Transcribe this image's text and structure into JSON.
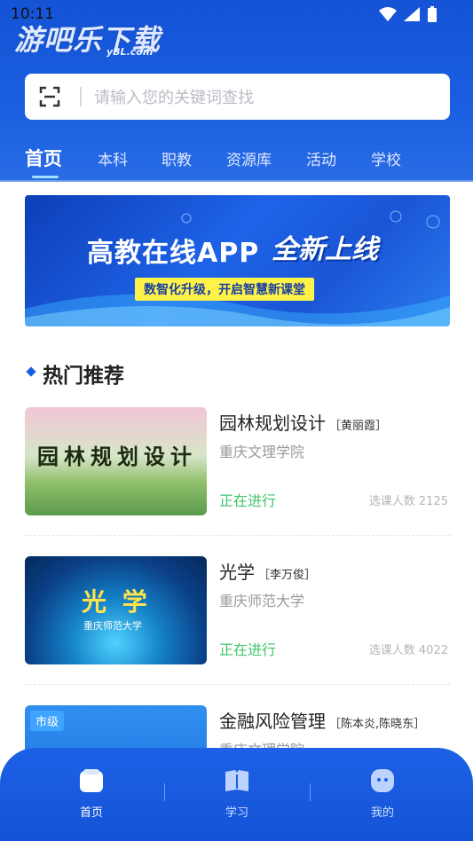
{
  "status_bar": {
    "time": "10:11"
  },
  "watermark": {
    "title": "游吧乐下载",
    "domain": "yBL.com"
  },
  "search": {
    "placeholder": "请输入您的关键词查找"
  },
  "tabs": [
    {
      "label": "首页"
    },
    {
      "label": "本科"
    },
    {
      "label": "职教"
    },
    {
      "label": "资源库"
    },
    {
      "label": "活动"
    },
    {
      "label": "学校"
    }
  ],
  "banner": {
    "title": "高教在线APP",
    "title_highlight": "全新上线",
    "subtitle": "数智化升级，开启智慧新课堂"
  },
  "section": {
    "title": "热门推荐"
  },
  "courses": [
    {
      "title": "园林规划设计",
      "teacher": "［黄丽霞］",
      "school": "重庆文理学院",
      "status": "正在进行",
      "count_label": "选课人数 2125",
      "thumb_text": "园林规划设计"
    },
    {
      "title": "光学",
      "teacher": "［李万俊］",
      "school": "重庆师范大学",
      "status": "正在进行",
      "count_label": "选课人数 4022",
      "thumb_text": "光 学",
      "thumb_sub": "重庆师范大学"
    },
    {
      "title": "金融风险管理",
      "teacher": "［陈本炎,陈晓东］",
      "school": "重庆文理学院",
      "thumb_badge": "市级"
    }
  ],
  "bottom_nav": [
    {
      "label": "首页"
    },
    {
      "label": "学习"
    },
    {
      "label": "我的"
    }
  ]
}
